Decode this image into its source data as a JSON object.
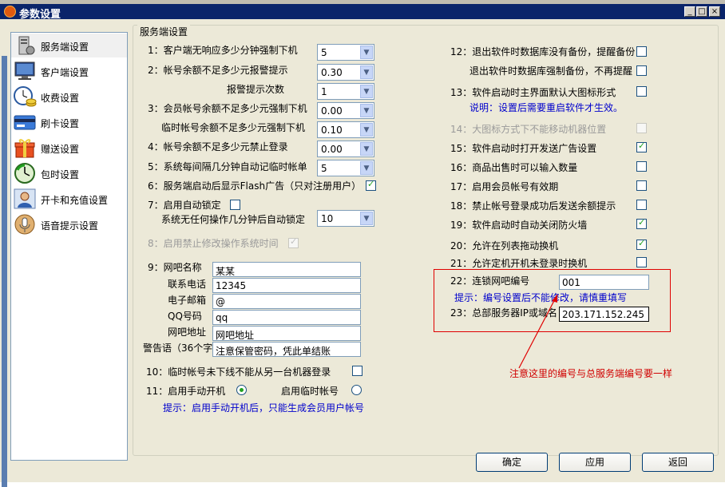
{
  "window": {
    "title": "参数设置",
    "controls": [
      "_",
      "□",
      "×"
    ]
  },
  "nav": {
    "items": [
      {
        "label": "服务端设置",
        "icon": "server-settings-icon",
        "selected": true
      },
      {
        "label": "客户端设置",
        "icon": "monitor-icon"
      },
      {
        "label": "收费设置",
        "icon": "clock-coins-icon"
      },
      {
        "label": "刷卡设置",
        "icon": "card-icon"
      },
      {
        "label": "赠送设置",
        "icon": "gift-icon"
      },
      {
        "label": "包时设置",
        "icon": "timer-icon"
      },
      {
        "label": "开卡和充值设置",
        "icon": "user-card-icon"
      },
      {
        "label": "语音提示设置",
        "icon": "microphone-icon"
      }
    ]
  },
  "group": {
    "title": "服务端设置"
  },
  "left": {
    "s1": {
      "label": "1：客户端无响应多少分钟强制下机",
      "value": "5"
    },
    "s2": {
      "label": "2：帐号余额不足多少元报警提示",
      "value": "0.30",
      "sub_label": "报警提示次数",
      "sub_value": "1"
    },
    "s3": {
      "label": "3：会员帐号余额不足多少元强制下机",
      "value": "0.00",
      "sub_label": "临时帐号余额不足多少元强制下机",
      "sub_value": "0.10"
    },
    "s4": {
      "label": "4：帐号余额不足多少元禁止登录",
      "value": "0.00"
    },
    "s5": {
      "label": "5：系统每间隔几分钟自动记临时帐单",
      "value": "5"
    },
    "s6": {
      "label": "6：服务端启动后显示Flash广告（只对注册用户）"
    },
    "s7": {
      "label": "7：启用自动锁定",
      "sub_label": "系统无任何操作几分钟后自动锁定",
      "value": "10"
    },
    "s8": {
      "label": "8：启用禁止修改操作系统时间"
    },
    "s9": {
      "label": "9：网吧名称",
      "name": "某某",
      "phone_label": "联系电话",
      "phone": "12345",
      "email_label": "电子邮箱",
      "email": "@",
      "qq_label": "QQ号码",
      "qq": "qq",
      "addr_label": "网吧地址",
      "addr": "网吧地址",
      "warn_label": "警告语（36个字）",
      "warn": "注意保管密码，凭此单结账"
    },
    "s10": {
      "label": "10：临时帐号未下线不能从另一台机器登录"
    },
    "s11": {
      "label": "11：启用手动开机",
      "label2": "启用临时帐号",
      "hint": "提示：启用手动开机后，只能生成会员用户帐号"
    }
  },
  "right": {
    "s12": {
      "label": "12：退出软件时数据库没有备份，提醒备份",
      "sub_label": "退出软件时数据库强制备份，不再提醒"
    },
    "s13": {
      "label": "13：软件启动时主界面默认大图标形式",
      "hint": "说明：设置后需要重启软件才生效。"
    },
    "s14": {
      "label": "14：大图标方式下不能移动机器位置"
    },
    "s15": {
      "label": "15：软件启动时打开发送广告设置"
    },
    "s16": {
      "label": "16：商品出售时可以输入数量"
    },
    "s17": {
      "label": "17：启用会员帐号有效期"
    },
    "s18": {
      "label": "18：禁止帐号登录成功后发送余额提示"
    },
    "s19": {
      "label": "19：软件启动时自动关闭防火墙"
    },
    "s20": {
      "label": "20：允许在列表拖动换机"
    },
    "s21": {
      "label": "21：允许定机开机未登录时换机"
    },
    "s22": {
      "label": "22：连锁网吧编号",
      "value": "001",
      "hint": "提示：编号设置后不能修改，请慎重填写"
    },
    "s23": {
      "label": "23：总部服务器IP或域名",
      "value": "203.171.152.245"
    }
  },
  "annotation": {
    "text": "注意这里的编号与总服务端编号要一样"
  },
  "buttons": {
    "ok": "确定",
    "apply": "应用",
    "back": "返回"
  },
  "colors": {
    "title_bar": "#0a246a",
    "hint": "#0000cc",
    "annotation": "#d00000",
    "check": "#21a121"
  }
}
